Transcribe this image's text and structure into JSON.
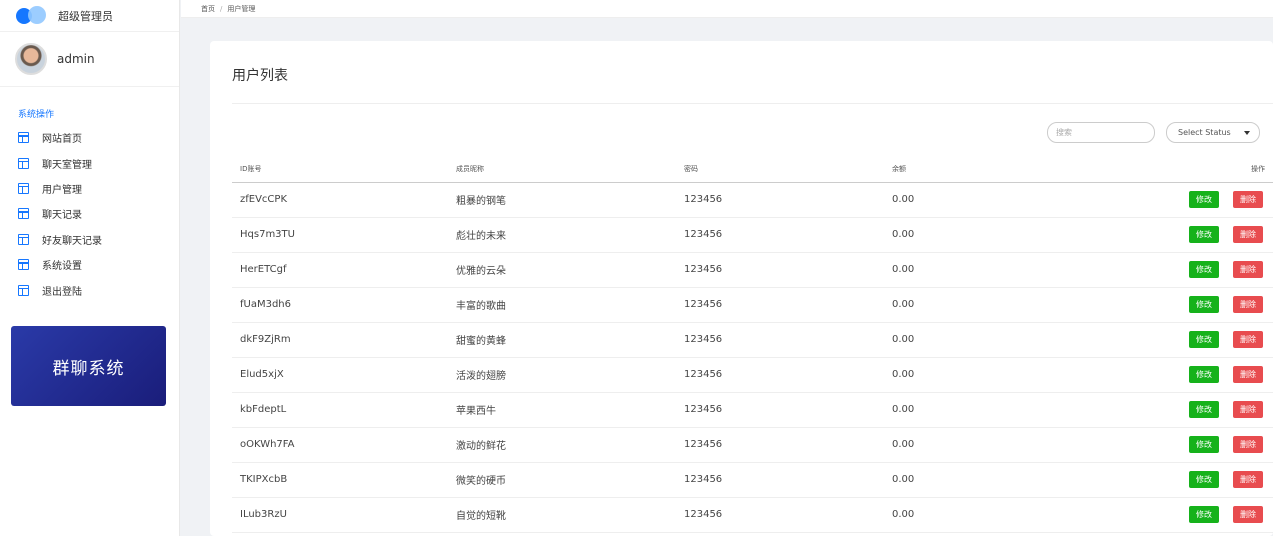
{
  "brand": {
    "title": "超级管理员"
  },
  "user": {
    "name": "admin"
  },
  "sidebar": {
    "section_label": "系统操作",
    "items": [
      {
        "label": "网站首页",
        "icon": "layout-icon"
      },
      {
        "label": "聊天室管理",
        "icon": "layout-icon"
      },
      {
        "label": "用户管理",
        "icon": "layout-icon"
      },
      {
        "label": "聊天记录",
        "icon": "layout-icon"
      },
      {
        "label": "好友聊天记录",
        "icon": "layout-icon"
      },
      {
        "label": "系统设置",
        "icon": "layout-icon"
      },
      {
        "label": "退出登陆",
        "icon": "layout-icon"
      }
    ],
    "promo": "群聊系统"
  },
  "breadcrumb": {
    "home": "首页",
    "separator": "/",
    "current": "用户管理"
  },
  "main": {
    "title": "用户列表",
    "search_placeholder": "搜索",
    "status_select": "Select Status"
  },
  "table": {
    "headers": {
      "id": "ID账号",
      "nickname": "成员昵称",
      "password": "密码",
      "balance": "余额",
      "actions": "操作"
    },
    "edit_label": "修改",
    "delete_label": "删除",
    "rows": [
      {
        "id": "zfEVcCPK",
        "nickname": "粗暴的钢笔",
        "password": "123456",
        "balance": "0.00"
      },
      {
        "id": "Hqs7m3TU",
        "nickname": "彪壮的未来",
        "password": "123456",
        "balance": "0.00"
      },
      {
        "id": "HerETCgf",
        "nickname": "优雅的云朵",
        "password": "123456",
        "balance": "0.00"
      },
      {
        "id": "fUaM3dh6",
        "nickname": "丰富的歌曲",
        "password": "123456",
        "balance": "0.00"
      },
      {
        "id": "dkF9ZjRm",
        "nickname": "甜蜜的黄蜂",
        "password": "123456",
        "balance": "0.00"
      },
      {
        "id": "Elud5xjX",
        "nickname": "活泼的翅膀",
        "password": "123456",
        "balance": "0.00"
      },
      {
        "id": "kbFdeptL",
        "nickname": "苹果西牛",
        "password": "123456",
        "balance": "0.00"
      },
      {
        "id": "oOKWh7FA",
        "nickname": "激动的鲜花",
        "password": "123456",
        "balance": "0.00"
      },
      {
        "id": "TKIPXcbB",
        "nickname": "微笑的硬币",
        "password": "123456",
        "balance": "0.00"
      },
      {
        "id": "ILub3RzU",
        "nickname": "自觉的短靴",
        "password": "123456",
        "balance": "0.00"
      }
    ]
  },
  "colors": {
    "accent": "#1677ff",
    "edit": "#16b21b",
    "delete": "#e84c4f",
    "promo": "#1f2a90"
  }
}
